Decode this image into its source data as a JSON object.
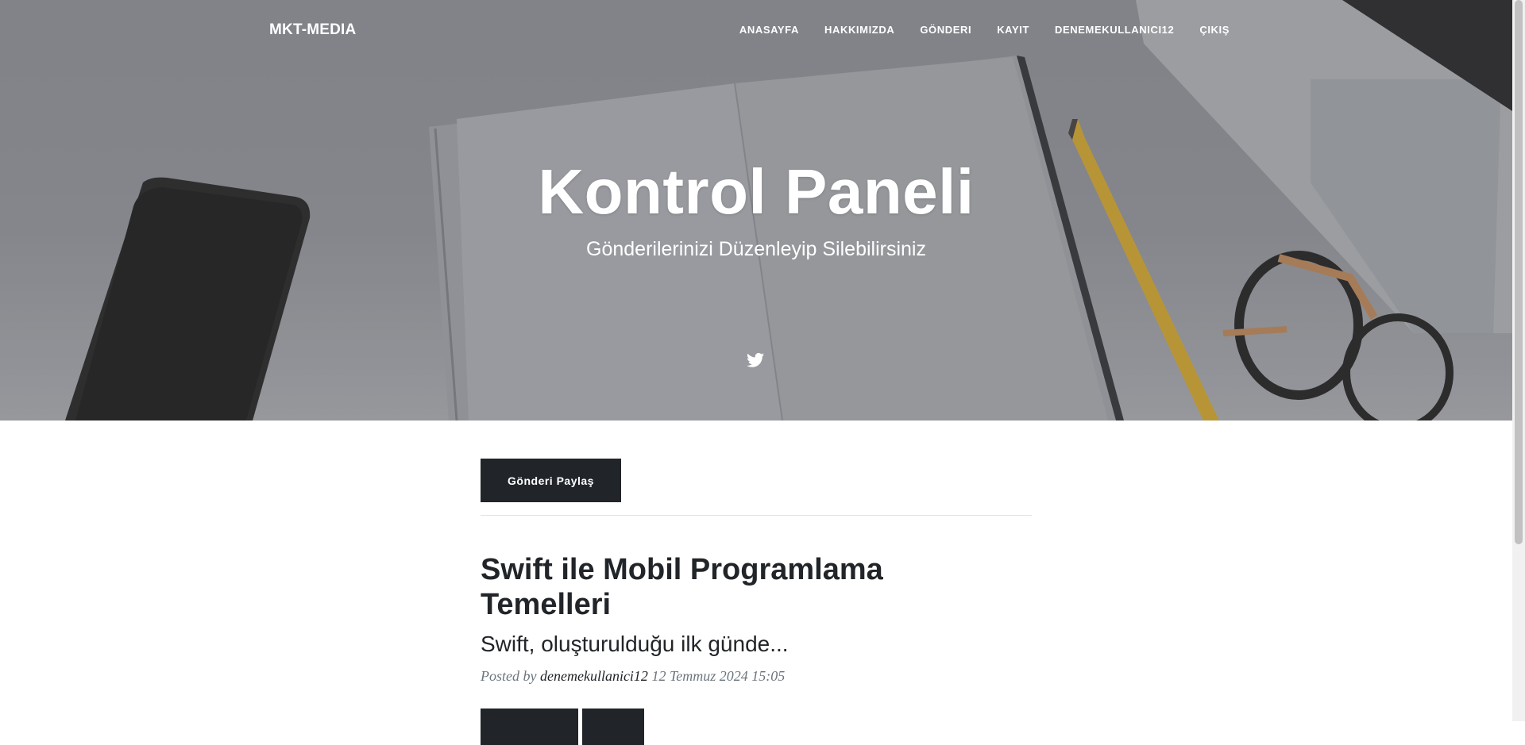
{
  "navbar": {
    "brand": "MKT-MEDIA",
    "items": [
      {
        "label": "ANASAYFA"
      },
      {
        "label": "HAKKIMIZDA"
      },
      {
        "label": "GÖNDERI"
      },
      {
        "label": "KAYIT"
      },
      {
        "label": "DENEMEKULLANICI12"
      },
      {
        "label": "ÇIKIŞ"
      }
    ]
  },
  "hero": {
    "title": "Kontrol Paneli",
    "subtitle": "Gönderilerinizi Düzenleyip Silebilirsiniz",
    "social_icon": "twitter-icon"
  },
  "actions": {
    "share_label": "Gönderi Paylaş"
  },
  "post": {
    "title": "Swift ile Mobil Programlama Temelleri",
    "subtitle": "Swift, oluşturulduğu ilk günde...",
    "posted_by_prefix": "Posted by",
    "author": "denemekullanici12",
    "date": "12 Temmuz 2024 15:05"
  },
  "colors": {
    "button_dark": "#212529",
    "meta_gray": "#6c757d",
    "hero_overlay": "#8b8c91"
  }
}
